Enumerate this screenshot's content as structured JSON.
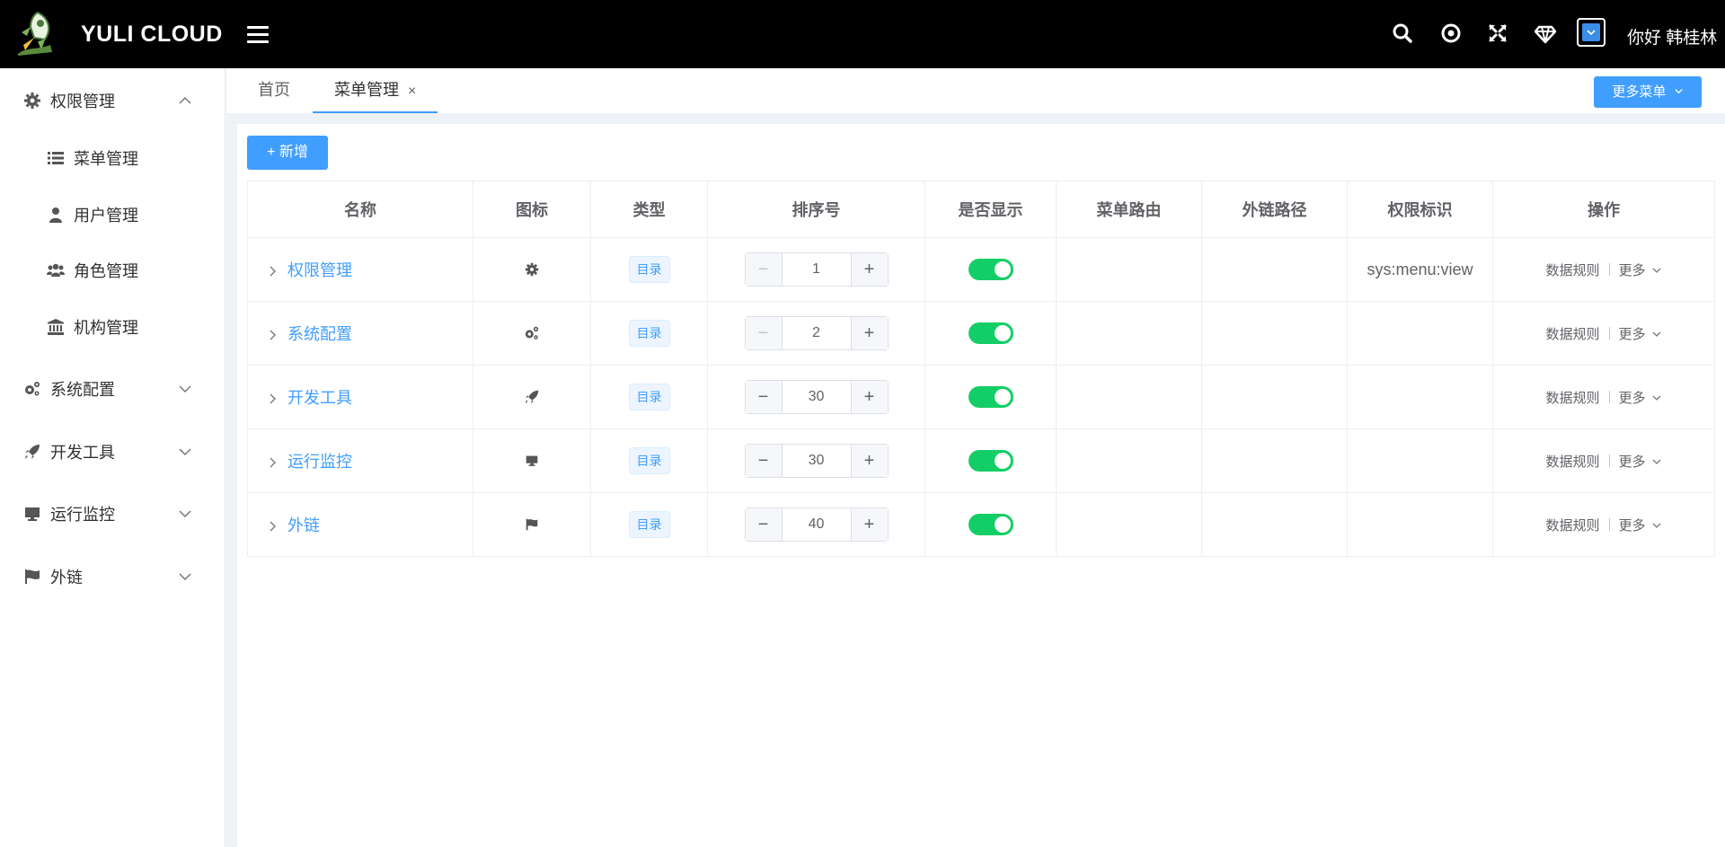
{
  "header": {
    "app_title": "YULI CLOUD",
    "greeting": "你好 韩桂林",
    "icons": [
      "search-icon",
      "target-icon",
      "fullscreen-icon",
      "diamond-icon",
      "dropdown-box-icon"
    ]
  },
  "sidebar": {
    "items": [
      {
        "label": "权限管理",
        "icon": "gear-icon",
        "expanded": true
      },
      {
        "label": "菜单管理",
        "icon": "list-icon"
      },
      {
        "label": "用户管理",
        "icon": "user-icon"
      },
      {
        "label": "角色管理",
        "icon": "users-icon"
      },
      {
        "label": "机构管理",
        "icon": "bank-icon"
      },
      {
        "label": "系统配置",
        "icon": "gears-icon",
        "expanded": false
      },
      {
        "label": "开发工具",
        "icon": "rocket-icon",
        "expanded": false
      },
      {
        "label": "运行监控",
        "icon": "monitor-icon",
        "expanded": false
      },
      {
        "label": "外链",
        "icon": "flag-icon",
        "expanded": false
      }
    ]
  },
  "tabs": {
    "items": [
      {
        "label": "首页"
      },
      {
        "label": "菜单管理",
        "close": "×",
        "active": true
      }
    ],
    "more_menu_label": "更多菜单"
  },
  "toolbar": {
    "add_label": "+ 新增"
  },
  "table": {
    "headers": [
      "名称",
      "图标",
      "类型",
      "排序号",
      "是否显示",
      "菜单路由",
      "外链路径",
      "权限标识",
      "操作"
    ],
    "rows": [
      {
        "name": "权限管理",
        "icon": "gear-icon",
        "type": "目录",
        "sort": "1",
        "visible": true,
        "route": "",
        "link": "",
        "perm": "sys:menu:view",
        "op1": "数据规则",
        "op2": "更多"
      },
      {
        "name": "系统配置",
        "icon": "gears-icon",
        "type": "目录",
        "sort": "2",
        "visible": true,
        "route": "",
        "link": "",
        "perm": "",
        "op1": "数据规则",
        "op2": "更多"
      },
      {
        "name": "开发工具",
        "icon": "rocket-icon",
        "type": "目录",
        "sort": "30",
        "visible": true,
        "route": "",
        "link": "",
        "perm": "",
        "op1": "数据规则",
        "op2": "更多"
      },
      {
        "name": "运行监控",
        "icon": "monitor-icon",
        "type": "目录",
        "sort": "30",
        "visible": true,
        "route": "",
        "link": "",
        "perm": "",
        "op1": "数据规则",
        "op2": "更多"
      },
      {
        "name": "外链",
        "icon": "flag-icon",
        "type": "目录",
        "sort": "40",
        "visible": true,
        "route": "",
        "link": "",
        "perm": "",
        "op1": "数据规则",
        "op2": "更多"
      }
    ]
  },
  "colors": {
    "primary": "#409eff",
    "switch_on": "#13ce66",
    "header_bg": "#000000"
  }
}
